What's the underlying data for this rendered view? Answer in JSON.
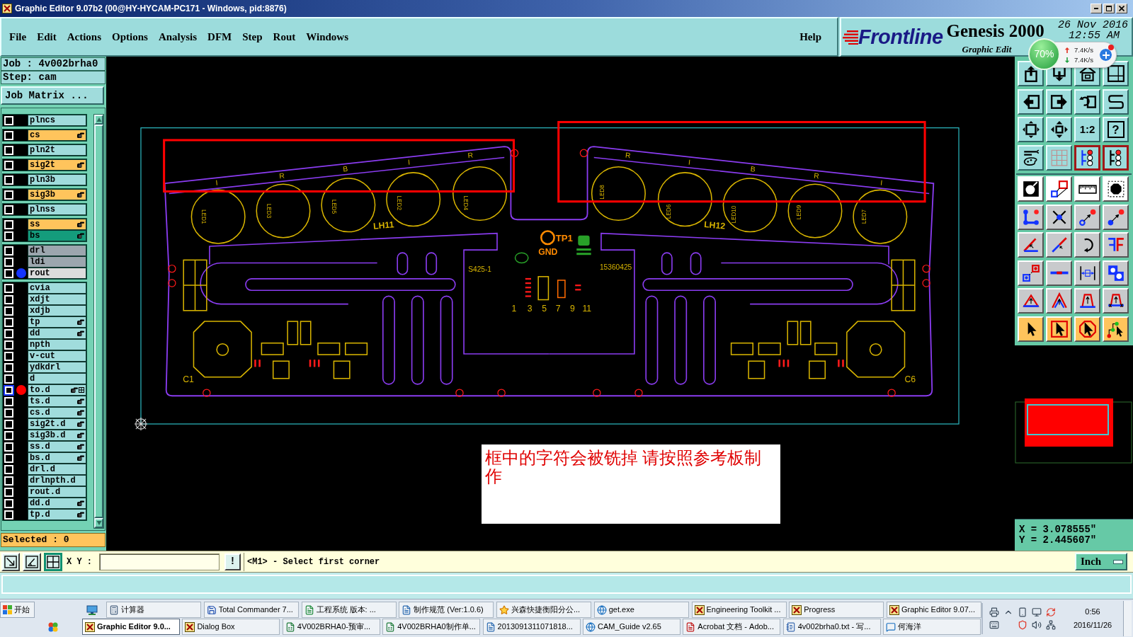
{
  "window": {
    "title": "Graphic Editor 9.07b2 (00@HY-HYCAM-PC171 - Windows, pid:8876)"
  },
  "menu": [
    "File",
    "Edit",
    "Actions",
    "Options",
    "Analysis",
    "DFM",
    "Step",
    "Rout",
    "Windows"
  ],
  "help_menu": "Help",
  "brand": {
    "logo": "Frontline",
    "product": "Genesis 2000",
    "date": "26 Nov 2016",
    "time": "12:55 AM",
    "subtitle": "Graphic Edit"
  },
  "speed_widget": {
    "percent": "70%",
    "upload": "7.4K/s",
    "download": "7.4K/s"
  },
  "job_panel": {
    "job": "Job : 4v002brha0",
    "step": "Step: cam",
    "matrix_button": "Job Matrix ...",
    "layer_groups": [
      [
        {
          "name": "plncs",
          "color": "#a0dcdc",
          "checked": false,
          "focused": false,
          "hand": false,
          "grid_mark": false
        }
      ],
      [
        {
          "name": "cs",
          "color": "#ffc45c",
          "checked": false,
          "focused": false,
          "hand": true,
          "grid_mark": false
        }
      ],
      [
        {
          "name": "pln2t",
          "color": "#a0dcdc",
          "checked": false,
          "focused": false,
          "hand": false,
          "grid_mark": false
        }
      ],
      [
        {
          "name": "sig2t",
          "color": "#ffc45c",
          "checked": false,
          "focused": false,
          "hand": true,
          "grid_mark": false
        }
      ],
      [
        {
          "name": "pln3b",
          "color": "#a0dcdc",
          "checked": false,
          "focused": false,
          "hand": false,
          "grid_mark": false
        }
      ],
      [
        {
          "name": "sig3b",
          "color": "#ffc45c",
          "checked": false,
          "focused": false,
          "hand": true,
          "grid_mark": false
        }
      ],
      [
        {
          "name": "plnss",
          "color": "#a0dcdc",
          "checked": false,
          "focused": false,
          "hand": false,
          "grid_mark": false
        }
      ],
      [
        {
          "name": "ss",
          "color": "#ffc45c",
          "checked": false,
          "focused": false,
          "hand": true,
          "grid_mark": false
        },
        {
          "name": "bs",
          "color": "#149c7c",
          "checked": false,
          "focused": false,
          "hand": true,
          "grid_mark": false
        }
      ],
      [
        {
          "name": "drl",
          "color": "#9ca6ae",
          "checked": false,
          "focused": false,
          "hand": false,
          "grid_mark": false
        },
        {
          "name": "ldi",
          "color": "#9ca6ae",
          "checked": false,
          "focused": false,
          "hand": false,
          "grid_mark": false
        },
        {
          "name": "rout",
          "color": "#dcdcdc",
          "dot": {
            "color": "#1434ff"
          },
          "checked": false,
          "focused": false,
          "hand": false,
          "grid_mark": false
        }
      ],
      [
        {
          "name": "cvia",
          "color": "#a0dcdc",
          "checked": false,
          "focused": false,
          "hand": false,
          "grid_mark": false
        },
        {
          "name": "xdjt",
          "color": "#a0dcdc",
          "checked": false,
          "focused": false,
          "hand": false,
          "grid_mark": false
        },
        {
          "name": "xdjb",
          "color": "#a0dcdc",
          "checked": false,
          "focused": false,
          "hand": false,
          "grid_mark": false
        },
        {
          "name": "tp",
          "color": "#a0dcdc",
          "checked": false,
          "focused": false,
          "hand": true,
          "grid_mark": false
        },
        {
          "name": "dd",
          "color": "#a0dcdc",
          "checked": false,
          "focused": false,
          "hand": true,
          "grid_mark": false
        },
        {
          "name": "npth",
          "color": "#a0dcdc",
          "checked": false,
          "focused": false,
          "hand": false,
          "grid_mark": false
        },
        {
          "name": "v-cut",
          "color": "#a0dcdc",
          "checked": false,
          "focused": false,
          "hand": false,
          "grid_mark": false
        },
        {
          "name": "ydkdrl",
          "color": "#a0dcdc",
          "checked": false,
          "focused": false,
          "hand": false,
          "grid_mark": false
        },
        {
          "name": "d",
          "color": "#a0dcdc",
          "checked": false,
          "focused": false,
          "hand": false,
          "grid_mark": false
        },
        {
          "name": "to.d",
          "color": "#a0dcdc",
          "dot": {
            "color": "#ff0000"
          },
          "checked": false,
          "focused": true,
          "hand": true,
          "grid_mark": true
        },
        {
          "name": "ts.d",
          "color": "#a0dcdc",
          "checked": false,
          "focused": false,
          "hand": true,
          "grid_mark": false
        },
        {
          "name": "cs.d",
          "color": "#a0dcdc",
          "checked": false,
          "focused": false,
          "hand": true,
          "grid_mark": false
        },
        {
          "name": "sig2t.d",
          "color": "#a0dcdc",
          "checked": false,
          "focused": false,
          "hand": true,
          "grid_mark": false
        },
        {
          "name": "sig3b.d",
          "color": "#a0dcdc",
          "checked": false,
          "focused": false,
          "hand": true,
          "grid_mark": false
        },
        {
          "name": "ss.d",
          "color": "#a0dcdc",
          "checked": false,
          "focused": false,
          "hand": true,
          "grid_mark": false
        },
        {
          "name": "bs.d",
          "color": "#a0dcdc",
          "checked": false,
          "focused": false,
          "hand": true,
          "grid_mark": false
        },
        {
          "name": "drl.d",
          "color": "#a0dcdc",
          "checked": false,
          "focused": false,
          "hand": false,
          "grid_mark": false
        },
        {
          "name": "drlnpth.d",
          "color": "#a0dcdc",
          "checked": false,
          "focused": false,
          "hand": false,
          "grid_mark": false
        },
        {
          "name": "rout.d",
          "color": "#a0dcdc",
          "checked": false,
          "focused": false,
          "hand": false,
          "grid_mark": false
        },
        {
          "name": "dd.d",
          "color": "#a0dcdc",
          "checked": false,
          "focused": false,
          "hand": true,
          "grid_mark": false
        },
        {
          "name": "tp.d",
          "color": "#a0dcdc",
          "checked": false,
          "focused": false,
          "hand": true,
          "grid_mark": false
        }
      ]
    ],
    "selected_count": "Selected : 0"
  },
  "board": {
    "strip_letters": [
      "I",
      "R",
      "B",
      "I",
      "R",
      "R",
      "I",
      "B",
      "R",
      "I"
    ],
    "led_labels": [
      "LED1",
      "LED3",
      "LED5",
      "LED2",
      "LED4",
      "LED8",
      "LED6",
      "LED10",
      "LED9",
      "LED7"
    ],
    "strip_names": [
      "LH11",
      "LH12"
    ],
    "test_point": "TP1",
    "ground": "GND",
    "part_codes": [
      "S425-1",
      "15360425"
    ],
    "capacitors": [
      "C1",
      "C6"
    ],
    "pin_numbers": [
      "1",
      "3",
      "5",
      "7",
      "9",
      "11"
    ]
  },
  "note": "框中的字符会被铣掉 请按照参考板制作",
  "toolbar": {
    "ratio_button": "1:2",
    "help_button": "?",
    "layer_view_buttons": [
      {
        "on": true
      },
      {
        "on": true
      }
    ]
  },
  "readout": {
    "x": "X = 3.078555\"",
    "y": "Y = 2.445607\""
  },
  "command_bar": {
    "mode_buttons": [
      {
        "selected": false
      },
      {
        "selected": false
      },
      {
        "selected": true
      }
    ],
    "xy_label": "X Y :",
    "run_button": "!",
    "prompt": "<M1> - Select first corner",
    "units": "Inch"
  },
  "taskbar": {
    "start": "开始",
    "rows": [
      [
        {
          "label": "计算器",
          "selected": false
        },
        {
          "label": "Total Commander 7...",
          "selected": false
        },
        {
          "label": "工程系统 版本: ...",
          "selected": false
        },
        {
          "label": "制作规范 (Ver:1.0.6)",
          "selected": false
        },
        {
          "label": "兴森快捷衡阳分公...",
          "selected": false
        },
        {
          "label": "get.exe",
          "selected": false
        },
        {
          "label": "Engineering Toolkit ...",
          "selected": false
        },
        {
          "label": "Progress",
          "selected": false
        },
        {
          "label": "Graphic Editor 9.07...",
          "selected": false
        }
      ],
      [
        {
          "label": "Graphic Editor 9.0...",
          "selected": true
        },
        {
          "label": "Dialog Box",
          "selected": false
        },
        {
          "label": "4V002BRHA0-预审...",
          "selected": false
        },
        {
          "label": "4V002BRHA0制作单...",
          "selected": false
        },
        {
          "label": "2013091311071818...",
          "selected": false
        },
        {
          "label": "CAM_Guide v2.65",
          "selected": false
        },
        {
          "label": "Acrobat 文档 - Adob...",
          "selected": false
        },
        {
          "label": "4v002brha0.txt - 写...",
          "selected": false
        },
        {
          "label": "何海洋",
          "selected": false
        }
      ]
    ],
    "clock": {
      "time": "0:56",
      "date": "2016/11/26"
    }
  }
}
